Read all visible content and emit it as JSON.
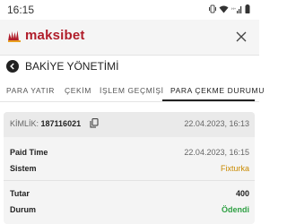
{
  "status_bar": {
    "time": "16:15"
  },
  "header": {
    "brand": "maksibet"
  },
  "page": {
    "title": "BAKİYE YÖNETİMİ"
  },
  "tabs": [
    {
      "label": "PARA YATIR"
    },
    {
      "label": "ÇEKİM"
    },
    {
      "label": "İŞLEM GEÇMİŞİ"
    },
    {
      "label": "PARA ÇEKME DURUMU"
    }
  ],
  "active_tab": "PARA ÇEKME DURUMU",
  "transaction": {
    "id_label": "KİMLİK:",
    "id_value": "187116021",
    "created_date": "22.04.2023, 16:13",
    "rows": [
      {
        "label": "Paid Time",
        "value": "22.04.2023, 16:15"
      },
      {
        "label": "Sistem",
        "value": "Fixturka"
      },
      {
        "label": "Tutar",
        "value": "400"
      },
      {
        "label": "Durum",
        "value": "Ödendi"
      }
    ]
  },
  "colors": {
    "brand": "#b01d2a",
    "system_value": "#c98a00",
    "status_paid": "#2ea043"
  }
}
